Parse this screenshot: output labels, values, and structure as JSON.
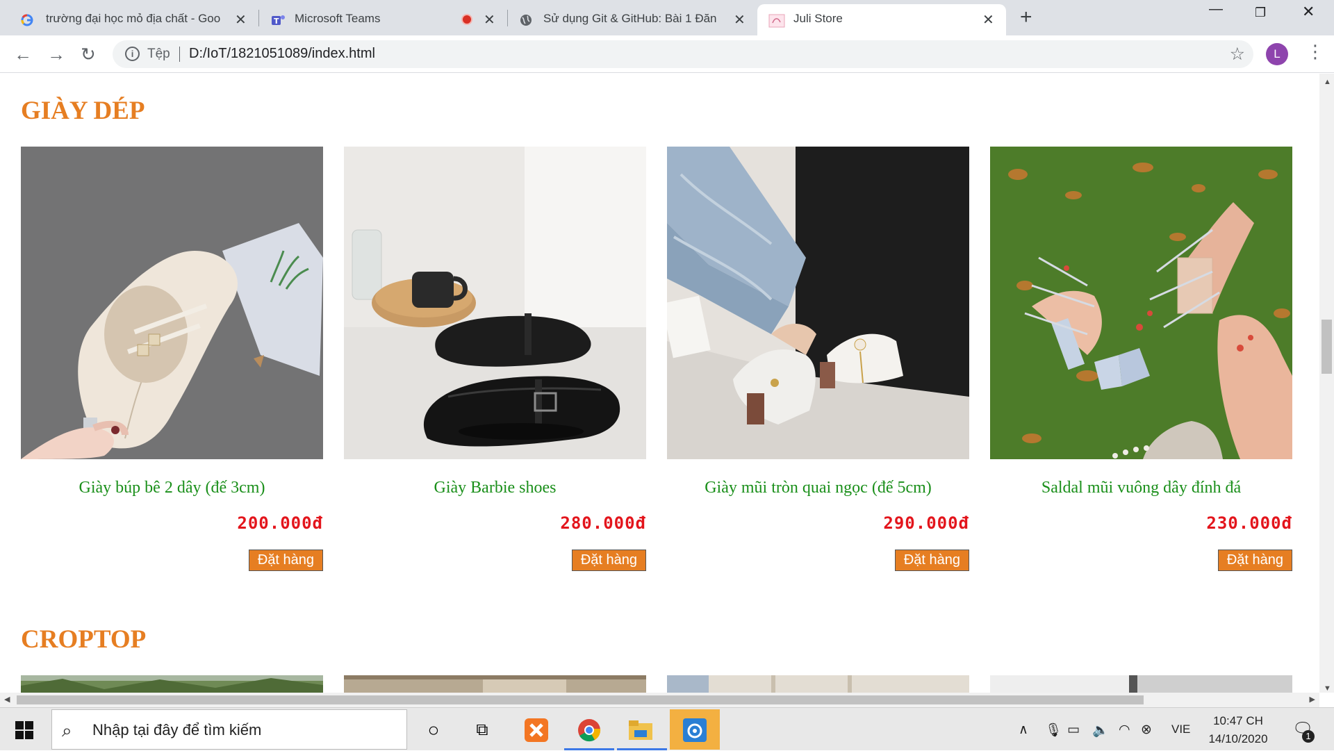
{
  "browser": {
    "tabs": [
      {
        "title": "trường đại học mỏ địa chất - Goo",
        "favicon": "google-icon"
      },
      {
        "title": "Microsoft Teams",
        "favicon": "teams-icon"
      },
      {
        "title": "Sử dụng Git & GitHub: Bài 1 Đăn",
        "favicon": "globe-icon"
      },
      {
        "title": "Juli Store",
        "favicon": "store-icon"
      }
    ],
    "address": {
      "protocol": "Tệp",
      "url": "D:/IoT/1821051089/index.html"
    },
    "profile_initial": "L"
  },
  "page": {
    "sections": [
      {
        "title": "GIÀY DÉP",
        "products": [
          {
            "name": "Giày búp bê 2 dây (đế 3cm)",
            "price": "200.000đ",
            "button": "Đặt hàng"
          },
          {
            "name": "Giày Barbie shoes",
            "price": "280.000đ",
            "button": "Đặt hàng"
          },
          {
            "name": "Giày mũi tròn quai ngọc (đế 5cm)",
            "price": "290.000đ",
            "button": "Đặt hàng"
          },
          {
            "name": "Saldal mũi vuông dây đính đá",
            "price": "230.000đ",
            "button": "Đặt hàng"
          }
        ]
      },
      {
        "title": "CROPTOP",
        "products": []
      }
    ]
  },
  "taskbar": {
    "search_placeholder": "Nhập tại đây để tìm kiếm",
    "language": "VIE",
    "time": "10:47 CH",
    "date": "14/10/2020",
    "notification_count": "1"
  },
  "colors": {
    "accent": "#e67e22",
    "product_name": "#1a8f1a",
    "price": "#e3151c"
  }
}
